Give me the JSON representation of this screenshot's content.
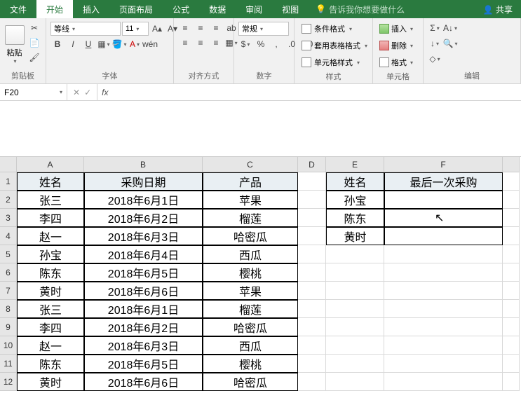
{
  "tabs": {
    "file": "文件",
    "home": "开始",
    "insert": "插入",
    "layout": "页面布局",
    "formulas": "公式",
    "data": "数据",
    "review": "审阅",
    "view": "视图"
  },
  "tellme_placeholder": "告诉我你想要做什么",
  "share": "共享",
  "ribbon": {
    "clipboard": {
      "paste": "粘贴",
      "label": "剪贴板"
    },
    "font": {
      "name": "等线",
      "size": "11",
      "label": "字体",
      "bold": "B",
      "italic": "I",
      "underline": "U"
    },
    "align": {
      "label": "对齐方式"
    },
    "number": {
      "format": "常规",
      "label": "数字"
    },
    "styles": {
      "conditional": "条件格式",
      "tableformat": "套用表格格式",
      "cellstyle": "单元格样式",
      "label": "样式"
    },
    "cells": {
      "insert": "插入",
      "delete": "删除",
      "format": "格式",
      "label": "单元格"
    },
    "editing": {
      "label": "编辑"
    }
  },
  "namebox": "F20",
  "columns": [
    "A",
    "B",
    "C",
    "D",
    "E",
    "F"
  ],
  "table1": {
    "headers": [
      "姓名",
      "采购日期",
      "产品"
    ],
    "rows": [
      [
        "张三",
        "2018年6月1日",
        "苹果"
      ],
      [
        "李四",
        "2018年6月2日",
        "榴莲"
      ],
      [
        "赵一",
        "2018年6月3日",
        "哈密瓜"
      ],
      [
        "孙宝",
        "2018年6月4日",
        "西瓜"
      ],
      [
        "陈东",
        "2018年6月5日",
        "樱桃"
      ],
      [
        "黄时",
        "2018年6月6日",
        "苹果"
      ],
      [
        "张三",
        "2018年6月1日",
        "榴莲"
      ],
      [
        "李四",
        "2018年6月2日",
        "哈密瓜"
      ],
      [
        "赵一",
        "2018年6月3日",
        "西瓜"
      ],
      [
        "陈东",
        "2018年6月5日",
        "樱桃"
      ],
      [
        "黄时",
        "2018年6月6日",
        "哈密瓜"
      ]
    ]
  },
  "table2": {
    "headers": [
      "姓名",
      "最后一次采购"
    ],
    "rows": [
      [
        "孙宝",
        ""
      ],
      [
        "陈东",
        ""
      ],
      [
        "黄时",
        ""
      ]
    ]
  }
}
